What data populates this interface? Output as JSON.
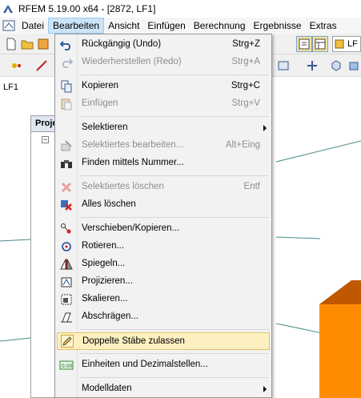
{
  "window": {
    "title": "RFEM 5.19.00 x64 - [2872, LF1]"
  },
  "menubar": {
    "items": [
      {
        "label": "Datei",
        "active": false
      },
      {
        "label": "Bearbeiten",
        "active": true
      },
      {
        "label": "Ansicht",
        "active": false
      },
      {
        "label": "Einfügen",
        "active": false
      },
      {
        "label": "Berechnung",
        "active": false
      },
      {
        "label": "Ergebnisse",
        "active": false
      },
      {
        "label": "Extras",
        "active": false
      }
    ]
  },
  "toolbar": {
    "combo_value": "LF"
  },
  "loadcase_bar": {
    "label": "LF1"
  },
  "project_panel": {
    "header": "Proje"
  },
  "edit_menu": {
    "items": [
      {
        "label": "Rückgängig (Undo)",
        "shortcut": "Strg+Z",
        "icon": "undo-icon",
        "disabled": false
      },
      {
        "label": "Wiederherstellen (Redo)",
        "shortcut": "Strg+A",
        "icon": "redo-icon",
        "disabled": true
      },
      {
        "label": "Kopieren",
        "shortcut": "Strg+C",
        "icon": "copy-icon",
        "disabled": false
      },
      {
        "label": "Einfügen",
        "shortcut": "Strg+V",
        "icon": "paste-icon",
        "disabled": true
      },
      {
        "label": "Selektieren",
        "shortcut": "",
        "icon": "",
        "disabled": false,
        "submenu": true
      },
      {
        "label": "Selektiertes bearbeiten...",
        "shortcut": "Alt+Eing",
        "icon": "edit-selected-icon",
        "disabled": true
      },
      {
        "label": "Finden mittels Nummer...",
        "shortcut": "",
        "icon": "binoculars-icon",
        "disabled": false
      },
      {
        "label": "Selektiertes löschen",
        "shortcut": "Entf",
        "icon": "delete-icon",
        "disabled": true
      },
      {
        "label": "Alles löschen",
        "shortcut": "",
        "icon": "delete-all-icon",
        "disabled": false
      },
      {
        "label": "Verschieben/Kopieren...",
        "shortcut": "",
        "icon": "move-copy-icon",
        "disabled": false
      },
      {
        "label": "Rotieren...",
        "shortcut": "",
        "icon": "rotate-icon",
        "disabled": false
      },
      {
        "label": "Spiegeln...",
        "shortcut": "",
        "icon": "mirror-icon",
        "disabled": false
      },
      {
        "label": "Projizieren...",
        "shortcut": "",
        "icon": "project-icon",
        "disabled": false
      },
      {
        "label": "Skalieren...",
        "shortcut": "",
        "icon": "scale-icon",
        "disabled": false
      },
      {
        "label": "Abschrägen...",
        "shortcut": "",
        "icon": "shear-icon",
        "disabled": false
      },
      {
        "label": "Doppelte Stäbe zulassen",
        "shortcut": "",
        "icon": "pencil-icon",
        "disabled": false,
        "highlighted": true
      },
      {
        "label": "Einheiten und Dezimalstellen...",
        "shortcut": "",
        "icon": "units-icon",
        "disabled": false
      },
      {
        "label": "Modelldaten",
        "shortcut": "",
        "icon": "",
        "disabled": false,
        "submenu": true
      }
    ]
  },
  "colors": {
    "menu_highlight": "#fcf0c1",
    "active_menu": "#cce4f7",
    "model_solid": "#ff8c00"
  }
}
